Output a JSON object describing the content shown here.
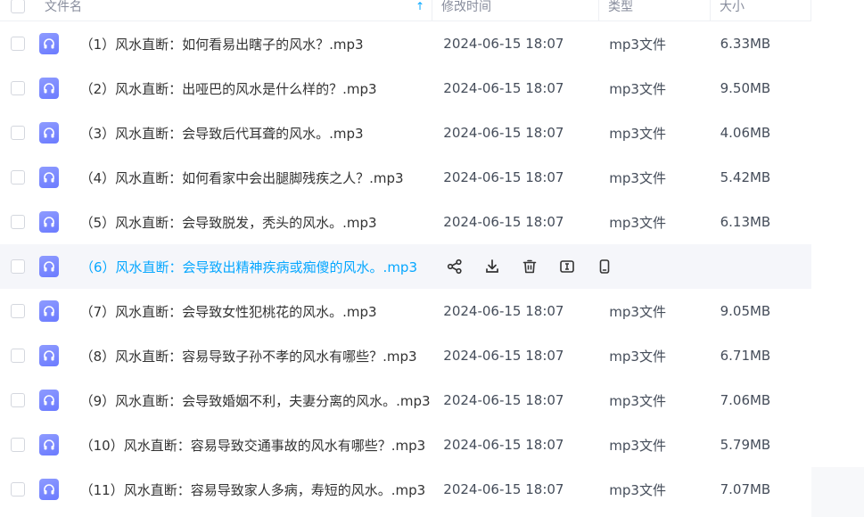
{
  "header": {
    "name_label": "文件名",
    "time_label": "修改时间",
    "type_label": "类型",
    "size_label": "大小"
  },
  "colors": {
    "accent": "#06a7ff",
    "icon": "#7684ff",
    "hover_row": "#f5f6fa"
  },
  "rows": [
    {
      "name": "（1）风水直断：如何看易出瞎子的风水？.mp3",
      "time": "2024-06-15 18:07",
      "type": "mp3文件",
      "size": "6.33MB"
    },
    {
      "name": "（2）风水直断：出哑巴的风水是什么样的？.mp3",
      "time": "2024-06-15 18:07",
      "type": "mp3文件",
      "size": "9.50MB"
    },
    {
      "name": "（3）风水直断：会导致后代耳聋的风水。.mp3",
      "time": "2024-06-15 18:07",
      "type": "mp3文件",
      "size": "4.06MB"
    },
    {
      "name": "（4）风水直断：如何看家中会出腿脚残疾之人？.mp3",
      "time": "2024-06-15 18:07",
      "type": "mp3文件",
      "size": "5.42MB"
    },
    {
      "name": "（5）风水直断：会导致脱发，秃头的风水。.mp3",
      "time": "2024-06-15 18:07",
      "type": "mp3文件",
      "size": "6.13MB"
    },
    {
      "name": "（6）风水直断：会导致出精神疾病或痴傻的风水。.mp3",
      "time": "",
      "type": "",
      "size": ""
    },
    {
      "name": "（7）风水直断：会导致女性犯桃花的风水。.mp3",
      "time": "2024-06-15 18:07",
      "type": "mp3文件",
      "size": "9.05MB"
    },
    {
      "name": "（8）风水直断：容易导致子孙不孝的风水有哪些？.mp3",
      "time": "2024-06-15 18:07",
      "type": "mp3文件",
      "size": "6.71MB"
    },
    {
      "name": "（9）风水直断：会导致婚姻不利，夫妻分离的风水。.mp3",
      "time": "2024-06-15 18:07",
      "type": "mp3文件",
      "size": "7.06MB"
    },
    {
      "name": "（10）风水直断：容易导致交通事故的风水有哪些？.mp3",
      "time": "2024-06-15 18:07",
      "type": "mp3文件",
      "size": "5.79MB"
    },
    {
      "name": "（11）风水直断：容易导致家人多病，寿短的风水。.mp3",
      "time": "2024-06-15 18:07",
      "type": "mp3文件",
      "size": "7.07MB"
    }
  ]
}
